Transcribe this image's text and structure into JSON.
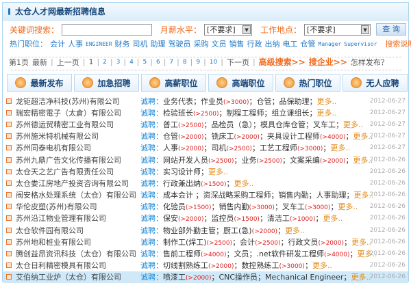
{
  "header": {
    "title": "太仓人才网最新招聘信息"
  },
  "search": {
    "keyword_label": "关键词搜索：",
    "keyword_value": "",
    "salary_label": "月薪水平：",
    "salary_value": "[不要求]",
    "location_label": "工作地点：",
    "location_value": "[不要求]",
    "button": "查 询"
  },
  "hot": {
    "label": "热门职位：",
    "items": [
      "会计",
      "人事",
      "ENGINEER",
      "财务",
      "司机",
      "助理",
      "驾驶员",
      "采购",
      "文员",
      "销售",
      "行政",
      "出纳",
      "电工",
      "仓管",
      "Manager",
      "Supervisor"
    ],
    "help": "搜索说明"
  },
  "pagination": {
    "current": "第1页",
    "latest": "最新",
    "prev": "上一页",
    "pages": [
      "1",
      "2",
      "3",
      "4",
      "5",
      "6",
      "7",
      "8",
      "9",
      "10"
    ],
    "next": "下一页",
    "advanced": "高级搜索>>",
    "company": "搜企业>>",
    "howto": "怎样发布？"
  },
  "buttons": [
    {
      "label": "最新发布",
      "icon": "new-icon"
    },
    {
      "label": "加急招聘",
      "icon": "megaphone-icon"
    },
    {
      "label": "高薪职位",
      "icon": "money-icon"
    },
    {
      "label": "高端职位",
      "icon": "diamond-icon"
    },
    {
      "label": "热门职位",
      "icon": "people-icon"
    },
    {
      "label": "无人应聘",
      "icon": "bulb-icon"
    }
  ],
  "recruit_label": "诚聘：",
  "more_label": "更多..",
  "rows": [
    {
      "company": "龙钜超洁净科技(苏州)有限公司",
      "jobs": [
        [
          "业务代表；作业员",
          ""
        ],
        [
          "(>3000)",
          1
        ],
        [
          "；仓管；品保助理；",
          ""
        ]
      ],
      "date": "2012-06-27"
    },
    {
      "company": "瑞宏精密電子（太倉）有限公司",
      "jobs": [
        [
          "检验班长",
          ""
        ],
        [
          "(>2500)",
          1
        ],
        [
          "；制程工程师；组立课组长；",
          ""
        ]
      ],
      "date": "2012-06-27"
    },
    {
      "company": "苏州德运贸精密工业有限公司",
      "jobs": [
        [
          "普工",
          ""
        ],
        [
          "(>2500)",
          1
        ],
        [
          "；品检员（急）；模具仓库仓管；叉车工；",
          ""
        ]
      ],
      "date": "2012-06-27"
    },
    {
      "company": "苏州施米特机械有限公司",
      "jobs": [
        [
          "仓管",
          ""
        ],
        [
          "(>2000)",
          1
        ],
        [
          "；铣床工",
          ""
        ],
        [
          "(>2000)",
          1
        ],
        [
          "；夹具设计工程师",
          ""
        ],
        [
          "(>4000)",
          1
        ],
        [
          "；",
          ""
        ]
      ],
      "date": "2012-06-27"
    },
    {
      "company": "苏州同泰电机有限公司",
      "jobs": [
        [
          "人事",
          ""
        ],
        [
          "(>2000)",
          1
        ],
        [
          "；司机",
          ""
        ],
        [
          "(>2500)",
          1
        ],
        [
          "；工艺工程师",
          ""
        ],
        [
          "(>3000)",
          1
        ],
        [
          "；",
          ""
        ]
      ],
      "date": "2012-06-27"
    },
    {
      "company": "苏州九鼎广告文化传播有限公司",
      "jobs": [
        [
          "网站开发人员",
          ""
        ],
        [
          "(>2500)",
          1
        ],
        [
          "；业务",
          ""
        ],
        [
          "(>2500)",
          1
        ],
        [
          "；文案采编",
          ""
        ],
        [
          "(>2000)",
          1
        ],
        [
          "；",
          ""
        ]
      ],
      "date": "2012-06-26"
    },
    {
      "company": "太仓天之艺广告有限责任公司",
      "jobs": [
        [
          "实习设计师；",
          ""
        ]
      ],
      "date": "2012-06-26"
    },
    {
      "company": "太仓娄江房地产投资咨询有限公司",
      "jobs": [
        [
          "行政兼出纳",
          ""
        ],
        [
          "(>1500)",
          1
        ],
        [
          "；",
          ""
        ]
      ],
      "date": "2012-06-26"
    },
    {
      "company": "阀安格水处理系统（太仓）有限公司",
      "jobs": [
        [
          "成本会计 ；资深战略采购工程师；销售内勤；人事助理；",
          ""
        ]
      ],
      "date": "2012-06-26"
    },
    {
      "company": "华伦皮塑(苏州)有限公司",
      "jobs": [
        [
          "化验员",
          ""
        ],
        [
          "(>1500)",
          1
        ],
        [
          "；销售内勤",
          ""
        ],
        [
          "(>3000)",
          1
        ],
        [
          "；叉车工",
          ""
        ],
        [
          "(>3000)",
          1
        ],
        [
          "；",
          ""
        ]
      ],
      "date": "2012-06-26"
    },
    {
      "company": "苏州沿江物业管理有限公司",
      "jobs": [
        [
          "保安",
          ""
        ],
        [
          "(>2000)",
          1
        ],
        [
          "；监控员",
          ""
        ],
        [
          "(>1500)",
          1
        ],
        [
          "；清洁工",
          ""
        ],
        [
          "(>1000)",
          1
        ],
        [
          "；",
          ""
        ]
      ],
      "date": "2012-06-26"
    },
    {
      "company": "太仓软件园有限公司",
      "jobs": [
        [
          "物业部外勤主管；厨工(急)",
          ""
        ],
        [
          "(>2000)",
          1
        ],
        [
          "；",
          ""
        ]
      ],
      "date": "2012-06-26"
    },
    {
      "company": "苏州地和桩业有限公司",
      "jobs": [
        [
          "制作工(焊工)",
          ""
        ],
        [
          "(>2500)",
          1
        ],
        [
          "；会计",
          ""
        ],
        [
          "(>2500)",
          1
        ],
        [
          "；行政文员",
          ""
        ],
        [
          "(>2000)",
          1
        ],
        [
          "；",
          ""
        ]
      ],
      "date": "2012-06-26"
    },
    {
      "company": "腾创益昂资讯科技（太仓）有限公司",
      "jobs": [
        [
          "售前工程师",
          ""
        ],
        [
          "(>4000)",
          1
        ],
        [
          "；文员；.net软件研发工程师",
          ""
        ],
        [
          "(>4000)",
          1
        ],
        [
          "；",
          ""
        ]
      ],
      "date": "2012-06-26"
    },
    {
      "company": "太仓日利精密模具有限公司",
      "jobs": [
        [
          "切线割熟练工",
          ""
        ],
        [
          "(>2000)",
          1
        ],
        [
          "；数控熟练工",
          ""
        ],
        [
          "(>3000)",
          1
        ],
        [
          "；",
          ""
        ]
      ],
      "date": "2012-06-26"
    },
    {
      "company": "艾伯纳工业炉（太仓）有限公司",
      "jobs": [
        [
          "喷漆工",
          ""
        ],
        [
          "(>2000)",
          1
        ],
        [
          "；CNC操作员；Mechanical Engineer；",
          ""
        ]
      ],
      "date": "2012-06-26"
    }
  ]
}
